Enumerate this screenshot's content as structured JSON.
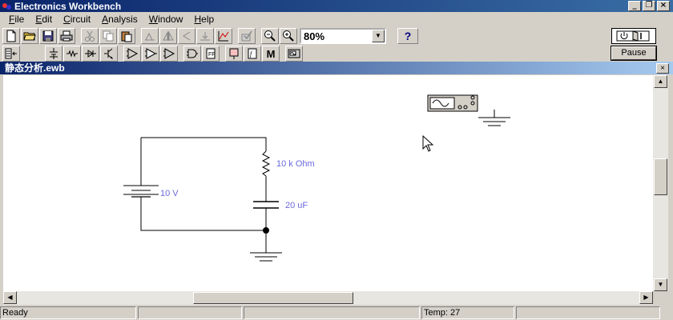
{
  "app": {
    "title": "Electronics Workbench"
  },
  "window_buttons": {
    "minimize": "_",
    "restore": "❐",
    "close": "×"
  },
  "menu": [
    {
      "label": "File",
      "key": "F",
      "rest": "ile"
    },
    {
      "label": "Edit",
      "key": "E",
      "rest": "dit"
    },
    {
      "label": "Circuit",
      "key": "C",
      "rest": "ircuit"
    },
    {
      "label": "Analysis",
      "key": "A",
      "rest": "nalysis"
    },
    {
      "label": "Window",
      "key": "W",
      "rest": "indow"
    },
    {
      "label": "Help",
      "key": "H",
      "rest": "elp"
    }
  ],
  "toolbar": {
    "zoom_value": "80%",
    "help_label": "?",
    "pause_label": "Pause",
    "component_M_label": "M"
  },
  "document": {
    "title": "静态分析.ewb"
  },
  "circuit": {
    "battery_label": "10 V",
    "resistor_label": "10 k Ohm",
    "capacitor_label": "20 uF"
  },
  "status": {
    "ready": "Ready",
    "temp": "Temp:  27"
  }
}
